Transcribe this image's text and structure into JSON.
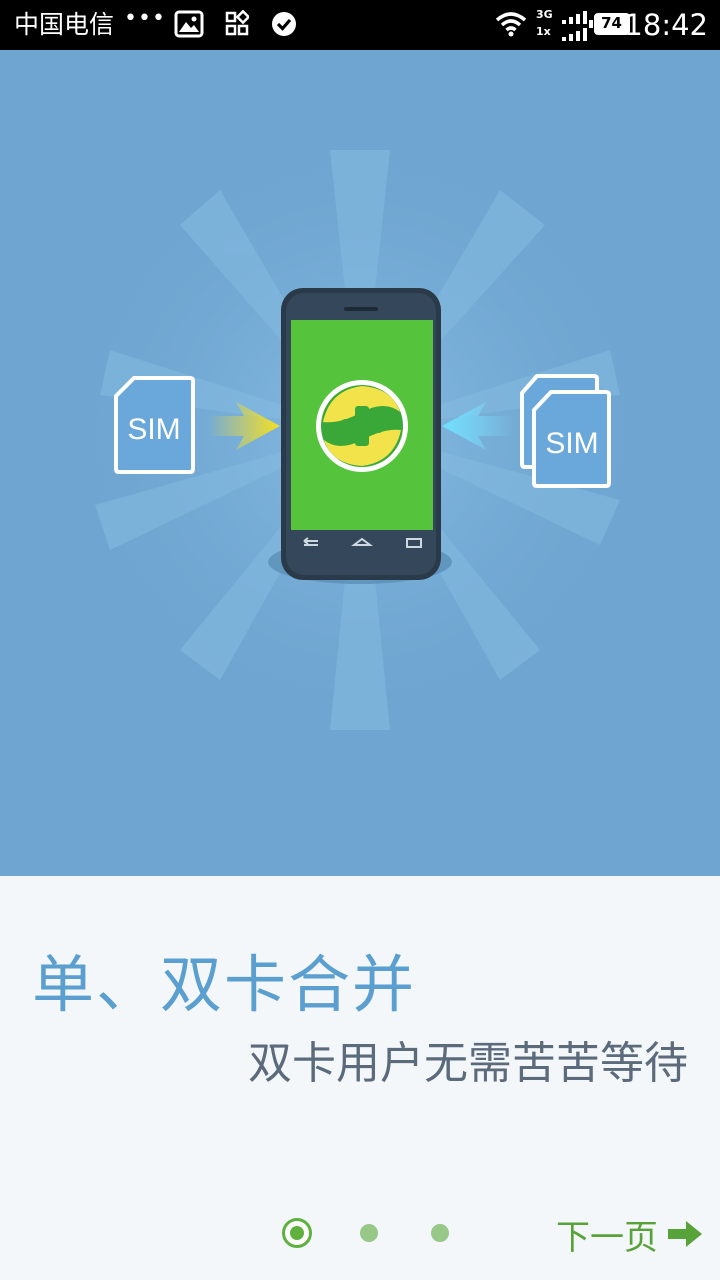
{
  "status_bar": {
    "carrier": "中国电信",
    "more_dots": "•••",
    "network_top": "3G",
    "network_bottom": "1x",
    "battery_level": "74",
    "time": "18:42"
  },
  "illustration": {
    "left_sim_label": "SIM",
    "right_sim_label": "SIM"
  },
  "content": {
    "headline": "单、双卡合并",
    "subline": "双卡用户无需苦苦等待"
  },
  "pager": {
    "total": 3,
    "active": 1
  },
  "next_button": {
    "label": "下一页"
  },
  "colors": {
    "hero_background": "#6fa6d1",
    "phone_screen": "#55c43c",
    "headline": "#5a9fd0",
    "accent_green": "#57a339"
  }
}
